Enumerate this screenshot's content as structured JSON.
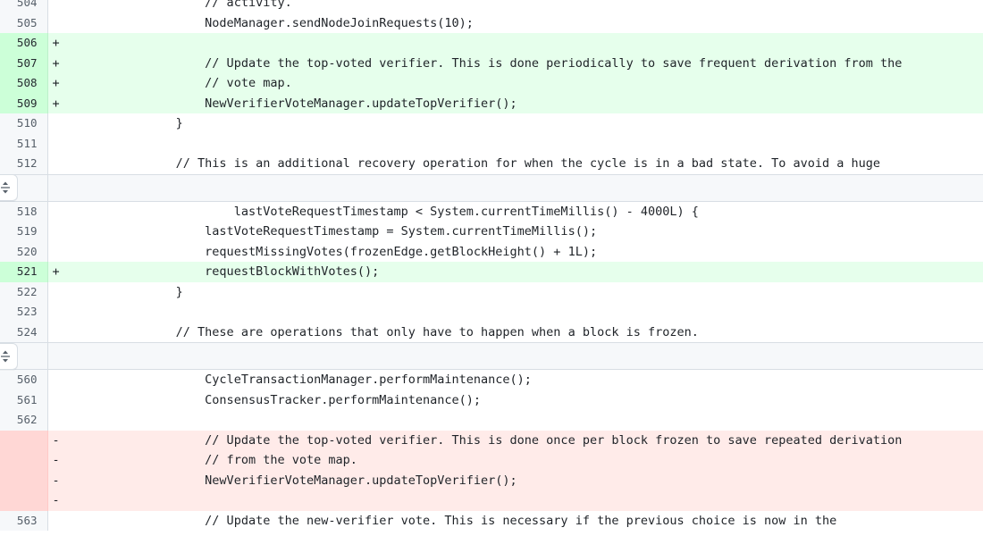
{
  "view": {
    "type": "unified-diff",
    "expand_icon": "unfold-up-down-icon",
    "added_line_bg": "#e6ffec",
    "added_gutter_bg": "#ccffd8",
    "deleted_line_bg": "#ffebe9",
    "deleted_gutter_bg": "#ffd7d5",
    "context_bg": "#ffffff",
    "gutter_bg": "#f6f8fa",
    "border_color": "#d8dee4",
    "text_color": "#1f2328",
    "line_number_color": "#57606a"
  },
  "hunks": [
    {
      "id": "hunk-1",
      "rows": [
        {
          "num": "504",
          "marker": "",
          "kind": "context",
          "code": "                    // activity."
        },
        {
          "num": "505",
          "marker": "",
          "kind": "context",
          "code": "                    NodeManager.sendNodeJoinRequests(10);"
        },
        {
          "num": "506",
          "marker": "+",
          "kind": "added",
          "code": ""
        },
        {
          "num": "507",
          "marker": "+",
          "kind": "added",
          "code": "                    // Update the top-voted verifier. This is done periodically to save frequent derivation from the"
        },
        {
          "num": "508",
          "marker": "+",
          "kind": "added",
          "code": "                    // vote map."
        },
        {
          "num": "509",
          "marker": "+",
          "kind": "added",
          "code": "                    NewVerifierVoteManager.updateTopVerifier();"
        },
        {
          "num": "510",
          "marker": "",
          "kind": "context",
          "code": "                }"
        },
        {
          "num": "511",
          "marker": "",
          "kind": "context",
          "code": ""
        },
        {
          "num": "512",
          "marker": "",
          "kind": "context",
          "code": "                // This is an additional recovery operation for when the cycle is in a bad state. To avoid a huge"
        }
      ]
    },
    {
      "id": "hunk-2",
      "rows": [
        {
          "num": "518",
          "marker": "",
          "kind": "context",
          "code": "                        lastVoteRequestTimestamp < System.currentTimeMillis() - 4000L) {"
        },
        {
          "num": "519",
          "marker": "",
          "kind": "context",
          "code": "                    lastVoteRequestTimestamp = System.currentTimeMillis();"
        },
        {
          "num": "520",
          "marker": "",
          "kind": "context",
          "code": "                    requestMissingVotes(frozenEdge.getBlockHeight() + 1L);"
        },
        {
          "num": "521",
          "marker": "+",
          "kind": "added",
          "code": "                    requestBlockWithVotes();"
        },
        {
          "num": "522",
          "marker": "",
          "kind": "context",
          "code": "                }"
        },
        {
          "num": "523",
          "marker": "",
          "kind": "context",
          "code": ""
        },
        {
          "num": "524",
          "marker": "",
          "kind": "context",
          "code": "                // These are operations that only have to happen when a block is frozen."
        }
      ]
    },
    {
      "id": "hunk-3",
      "rows": [
        {
          "num": "560",
          "marker": "",
          "kind": "context",
          "code": "                    CycleTransactionManager.performMaintenance();"
        },
        {
          "num": "561",
          "marker": "",
          "kind": "context",
          "code": "                    ConsensusTracker.performMaintenance();"
        },
        {
          "num": "562",
          "marker": "",
          "kind": "context",
          "code": ""
        },
        {
          "num": "",
          "marker": "-",
          "kind": "deleted",
          "code": "                    // Update the top-voted verifier. This is done once per block frozen to save repeated derivation"
        },
        {
          "num": "",
          "marker": "-",
          "kind": "deleted",
          "code": "                    // from the vote map."
        },
        {
          "num": "",
          "marker": "-",
          "kind": "deleted",
          "code": "                    NewVerifierVoteManager.updateTopVerifier();"
        },
        {
          "num": "",
          "marker": "-",
          "kind": "deleted",
          "code": ""
        },
        {
          "num": "563",
          "marker": "",
          "kind": "context",
          "code": "                    // Update the new-verifier vote. This is necessary if the previous choice is now in the"
        }
      ]
    }
  ]
}
